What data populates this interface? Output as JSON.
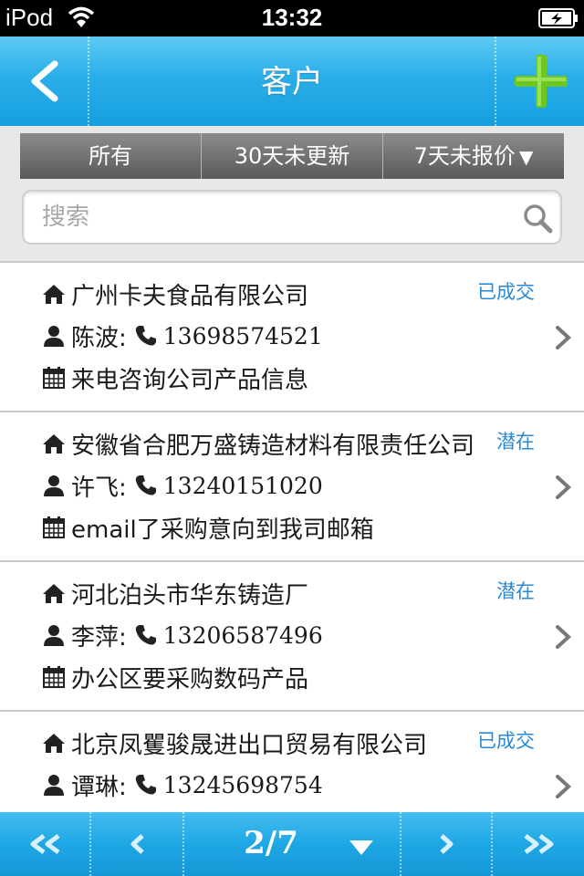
{
  "status_bar": {
    "carrier": "iPod",
    "time": "13:32"
  },
  "nav": {
    "title": "客户",
    "back_icon": "back-chevron-icon",
    "add_icon": "plus-icon"
  },
  "filters": {
    "tabs": [
      "所有",
      "30天未更新",
      "7天未报价"
    ],
    "dropdown_arrow": "▼"
  },
  "search": {
    "placeholder": "搜索",
    "value": ""
  },
  "customers": [
    {
      "company": "广州卡夫食品有限公司",
      "contact": "陈波:",
      "phone": "13698574521",
      "note": "来电咨询公司产品信息",
      "status": "已成交"
    },
    {
      "company": "安徽省合肥万盛铸造材料有限责任公司",
      "contact": "许飞:",
      "phone": "13240151020",
      "note": "email了采购意向到我司邮箱",
      "status": "潜在"
    },
    {
      "company": "河北泊头市华东铸造厂",
      "contact": "李萍:",
      "phone": "13206587496",
      "note": "办公区要采购数码产品",
      "status": "潜在"
    },
    {
      "company": "北京凤矍骏晟进出口贸易有限公司",
      "contact": "谭琳:",
      "phone": "13245698754",
      "note": "",
      "status": "已成交"
    }
  ],
  "pager": {
    "page": "2/7"
  },
  "colors": {
    "nav_blue": "#2aaee8",
    "status_blue": "#2a8ad6",
    "add_green": "#6cc81e"
  }
}
